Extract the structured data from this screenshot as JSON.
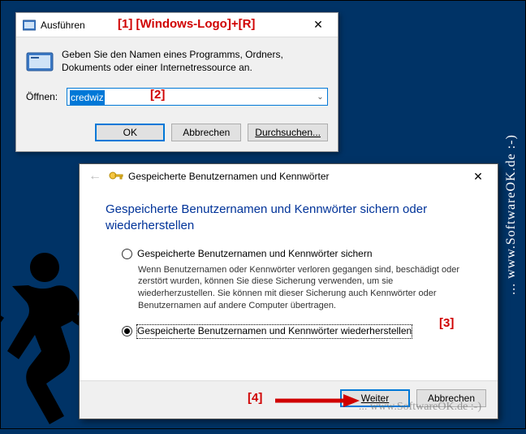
{
  "watermark": "... www.SoftwareOK.de :-)",
  "watermark_inline": "... www.SoftwareOK.de :-)",
  "run": {
    "title": "Ausführen",
    "description": "Geben Sie den Namen eines Programms, Ordners, Dokuments oder einer Internetressource an.",
    "open_label": "Öffnen:",
    "input_value": "credwiz",
    "btn_ok": "OK",
    "btn_cancel": "Abbrechen",
    "btn_browse": "Durchsuchen..."
  },
  "wizard": {
    "title": "Gespeicherte Benutzernamen und Kennwörter",
    "heading": "Gespeicherte Benutzernamen und Kennwörter sichern oder wiederherstellen",
    "option_backup": "Gespeicherte Benutzernamen und Kennwörter sichern",
    "backup_desc": "Wenn Benutzernamen oder Kennwörter verloren gegangen sind, beschädigt oder zerstört wurden, können Sie diese Sicherung verwenden, um sie wiederherzustellen. Sie können mit dieser Sicherung auch Kennwörter oder Benutzernamen auf andere Computer übertragen.",
    "option_restore": "Gespeicherte Benutzernamen und Kennwörter wiederherstellen",
    "btn_next": "Weiter",
    "btn_cancel": "Abbrechen"
  },
  "annotations": {
    "a1": "[1]  [Windows-Logo]+[R]",
    "a2": "[2]",
    "a3": "[3]",
    "a4": "[4]"
  }
}
